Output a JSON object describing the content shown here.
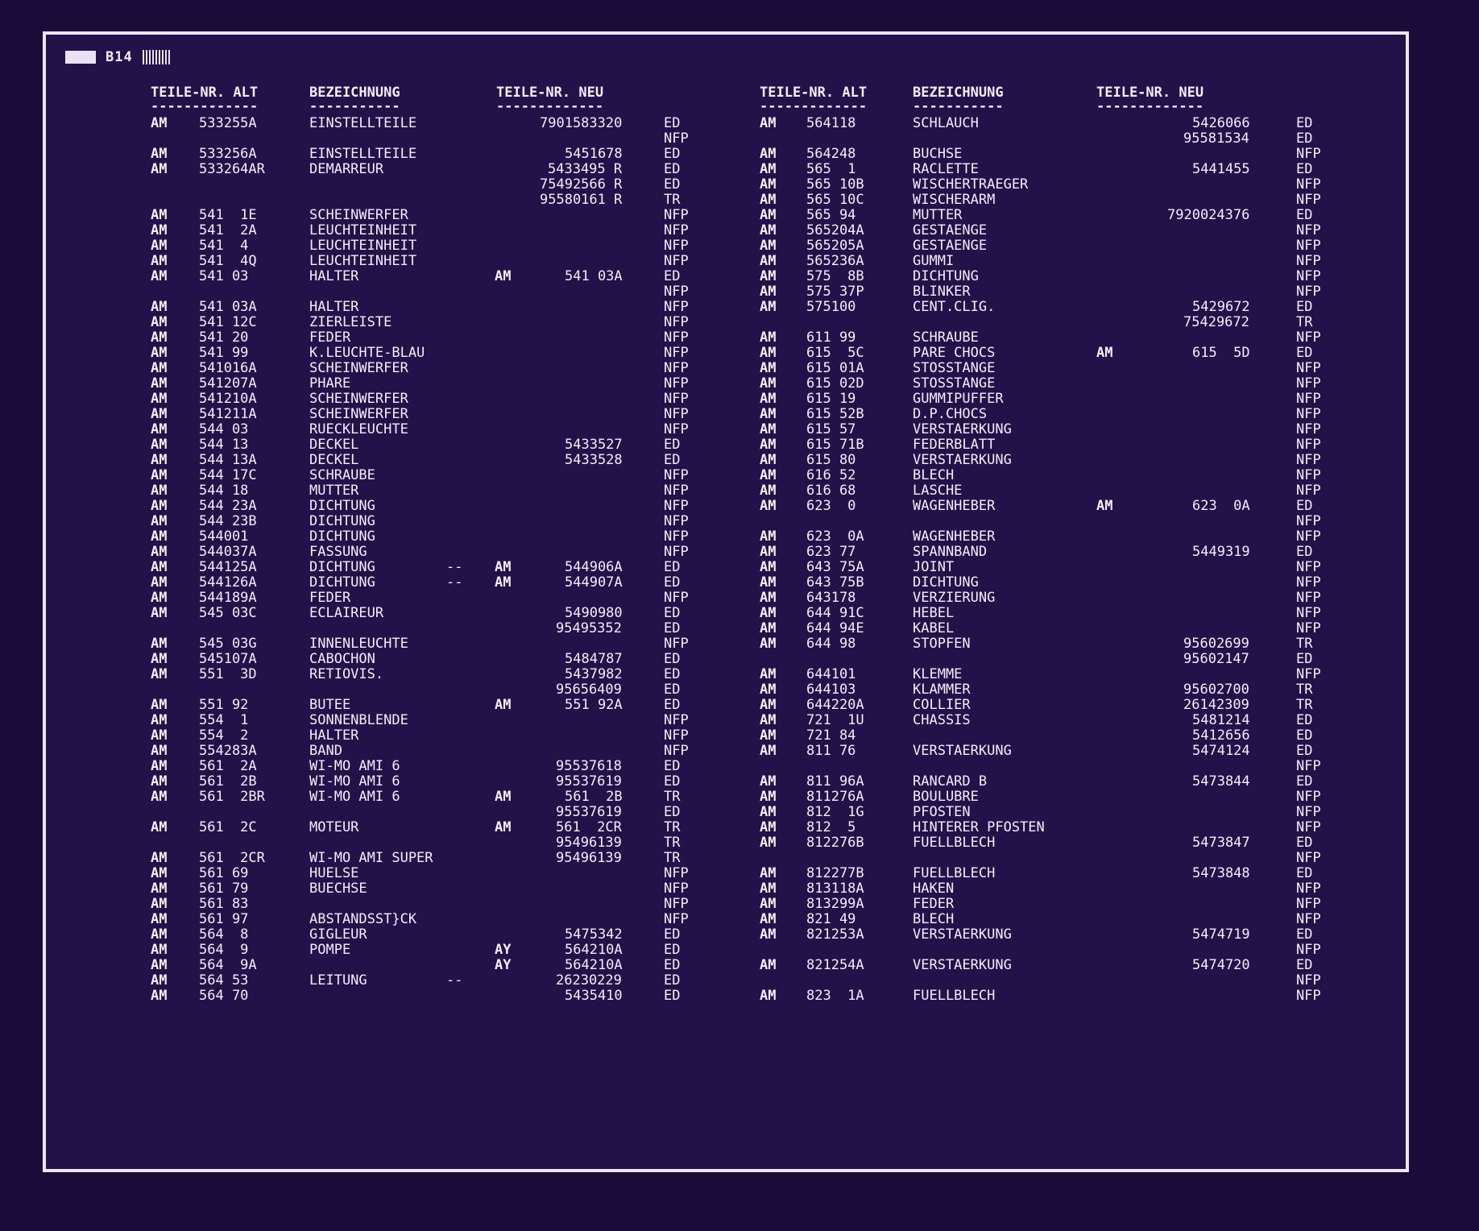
{
  "page_label": "B14",
  "headers": {
    "alt": "TEILE-NR. ALT",
    "bez": "BEZEICHNUNG",
    "neu": "TEILE-NR. NEU",
    "underline_alt": "-------------",
    "underline_bez": "-----------",
    "underline_neu": "-------------"
  },
  "left_rows": [
    {
      "p": "AM",
      "alt": "533255A",
      "bez": "EINSTELLTEILE",
      "neu": "7901583320",
      "code": "ED"
    },
    {
      "p": "",
      "alt": "",
      "bez": "",
      "neu": "",
      "code": "NFP"
    },
    {
      "p": "AM",
      "alt": "533256A",
      "bez": "EINSTELLTEILE",
      "neu": "5451678",
      "code": "ED"
    },
    {
      "p": "AM",
      "alt": "533264AR",
      "bez": "DEMARREUR",
      "neu": "5433495 R",
      "code": "ED"
    },
    {
      "p": "",
      "alt": "",
      "bez": "",
      "neu": "75492566 R",
      "code": "ED"
    },
    {
      "p": "",
      "alt": "",
      "bez": "",
      "neu": "95580161 R",
      "code": "TR"
    },
    {
      "p": "AM",
      "alt": "541  1E",
      "bez": "SCHEINWERFER",
      "neu": "",
      "code": "NFP"
    },
    {
      "p": "AM",
      "alt": "541  2A",
      "bez": "LEUCHTEINHEIT",
      "neu": "",
      "code": "NFP"
    },
    {
      "p": "AM",
      "alt": "541  4",
      "bez": "LEUCHTEINHEIT",
      "neu": "",
      "code": "NFP"
    },
    {
      "p": "AM",
      "alt": "541  4Q",
      "bez": "LEUCHTEINHEIT",
      "neu": "",
      "code": "NFP"
    },
    {
      "p": "AM",
      "alt": "541 03",
      "bez": "HALTER",
      "np": "AM",
      "neu": "541 03A",
      "code": "ED"
    },
    {
      "p": "",
      "alt": "",
      "bez": "",
      "neu": "",
      "code": "NFP"
    },
    {
      "p": "AM",
      "alt": "541 03A",
      "bez": "HALTER",
      "neu": "",
      "code": "NFP"
    },
    {
      "p": "AM",
      "alt": "541 12C",
      "bez": "ZIERLEISTE",
      "neu": "",
      "code": "NFP"
    },
    {
      "p": "AM",
      "alt": "541 20",
      "bez": "FEDER",
      "neu": "",
      "code": "NFP"
    },
    {
      "p": "AM",
      "alt": "541 99",
      "bez": "K.LEUCHTE-BLAU",
      "neu": "",
      "code": "NFP"
    },
    {
      "p": "AM",
      "alt": "541016A",
      "bez": "SCHEINWERFER",
      "neu": "",
      "code": "NFP"
    },
    {
      "p": "AM",
      "alt": "541207A",
      "bez": "PHARE",
      "neu": "",
      "code": "NFP"
    },
    {
      "p": "AM",
      "alt": "541210A",
      "bez": "SCHEINWERFER",
      "neu": "",
      "code": "NFP"
    },
    {
      "p": "AM",
      "alt": "541211A",
      "bez": "SCHEINWERFER",
      "neu": "",
      "code": "NFP"
    },
    {
      "p": "AM",
      "alt": "544 03",
      "bez": "RUECKLEUCHTE",
      "neu": "",
      "code": "NFP"
    },
    {
      "p": "AM",
      "alt": "544 13",
      "bez": "DECKEL",
      "neu": "5433527",
      "code": "ED"
    },
    {
      "p": "AM",
      "alt": "544 13A",
      "bez": "DECKEL",
      "neu": "5433528",
      "code": "ED"
    },
    {
      "p": "AM",
      "alt": "544 17C",
      "bez": "SCHRAUBE",
      "neu": "",
      "code": "NFP"
    },
    {
      "p": "AM",
      "alt": "544 18",
      "bez": "MUTTER",
      "neu": "",
      "code": "NFP"
    },
    {
      "p": "AM",
      "alt": "544 23A",
      "bez": "DICHTUNG",
      "neu": "",
      "code": "NFP"
    },
    {
      "p": "AM",
      "alt": "544 23B",
      "bez": "DICHTUNG",
      "neu": "",
      "code": "NFP"
    },
    {
      "p": "AM",
      "alt": "544001",
      "bez": "DICHTUNG",
      "neu": "",
      "code": "NFP"
    },
    {
      "p": "AM",
      "alt": "544037A",
      "bez": "FASSUNG",
      "neu": "",
      "code": "NFP"
    },
    {
      "p": "AM",
      "alt": "544125A",
      "bez": "DICHTUNG",
      "d": "--",
      "np": "AM",
      "neu": "544906A",
      "code": "ED"
    },
    {
      "p": "AM",
      "alt": "544126A",
      "bez": "DICHTUNG",
      "d": "--",
      "np": "AM",
      "neu": "544907A",
      "code": "ED"
    },
    {
      "p": "AM",
      "alt": "544189A",
      "bez": "FEDER",
      "neu": "",
      "code": "NFP"
    },
    {
      "p": "AM",
      "alt": "545 03C",
      "bez": "ECLAIREUR",
      "neu": "5490980",
      "code": "ED"
    },
    {
      "p": "",
      "alt": "",
      "bez": "",
      "neu": "95495352",
      "code": "ED"
    },
    {
      "p": "AM",
      "alt": "545 03G",
      "bez": "INNENLEUCHTE",
      "neu": "",
      "code": "NFP"
    },
    {
      "p": "AM",
      "alt": "545107A",
      "bez": "CABOCHON",
      "neu": "5484787",
      "code": "ED"
    },
    {
      "p": "AM",
      "alt": "551  3D",
      "bez": "RETIOVIS.",
      "neu": "5437982",
      "code": "ED"
    },
    {
      "p": "",
      "alt": "",
      "bez": "",
      "neu": "95656409",
      "code": "ED"
    },
    {
      "p": "AM",
      "alt": "551 92",
      "bez": "BUTEE",
      "np": "AM",
      "neu": "551 92A",
      "code": "ED"
    },
    {
      "p": "AM",
      "alt": "554  1",
      "bez": "SONNENBLENDE",
      "neu": "",
      "code": "NFP"
    },
    {
      "p": "AM",
      "alt": "554  2",
      "bez": "HALTER",
      "neu": "",
      "code": "NFP"
    },
    {
      "p": "AM",
      "alt": "554283A",
      "bez": "BAND",
      "neu": "",
      "code": "NFP"
    },
    {
      "p": "AM",
      "alt": "561  2A",
      "bez": "WI-MO AMI 6",
      "neu": "95537618",
      "code": "ED"
    },
    {
      "p": "AM",
      "alt": "561  2B",
      "bez": "WI-MO AMI 6",
      "neu": "95537619",
      "code": "ED"
    },
    {
      "p": "AM",
      "alt": "561  2BR",
      "bez": "WI-MO AMI 6",
      "np": "AM",
      "neu": "561  2B",
      "code": "TR"
    },
    {
      "p": "",
      "alt": "",
      "bez": "",
      "neu": "95537619",
      "code": "ED"
    },
    {
      "p": "AM",
      "alt": "561  2C",
      "bez": "MOTEUR",
      "np": "AM",
      "neu": "561  2CR",
      "code": "TR"
    },
    {
      "p": "",
      "alt": "",
      "bez": "",
      "neu": "95496139",
      "code": "TR"
    },
    {
      "p": "AM",
      "alt": "561  2CR",
      "bez": "WI-MO AMI SUPER",
      "neu": "95496139",
      "code": "TR"
    },
    {
      "p": "AM",
      "alt": "561 69",
      "bez": "HUELSE",
      "neu": "",
      "code": "NFP"
    },
    {
      "p": "AM",
      "alt": "561 79",
      "bez": "BUECHSE",
      "neu": "",
      "code": "NFP"
    },
    {
      "p": "AM",
      "alt": "561 83",
      "bez": "",
      "neu": "",
      "code": "NFP"
    },
    {
      "p": "AM",
      "alt": "561 97",
      "bez": "ABSTANDSST}CK",
      "neu": "",
      "code": "NFP"
    },
    {
      "p": "AM",
      "alt": "564  8",
      "bez": "GIGLEUR",
      "neu": "5475342",
      "code": "ED"
    },
    {
      "p": "AM",
      "alt": "564  9",
      "bez": "POMPE",
      "np": "AY",
      "neu": "564210A",
      "code": "ED"
    },
    {
      "p": "AM",
      "alt": "564  9A",
      "bez": "",
      "np": "AY",
      "neu": "564210A",
      "code": "ED"
    },
    {
      "p": "AM",
      "alt": "564 53",
      "bez": "LEITUNG",
      "d": "--",
      "neu": "26230229",
      "code": "ED"
    },
    {
      "p": "AM",
      "alt": "564 70",
      "bez": "",
      "neu": "5435410",
      "code": "ED"
    }
  ],
  "right_rows": [
    {
      "p": "AM",
      "alt": "564118",
      "bez": "SCHLAUCH",
      "neu": "5426066",
      "code": "ED"
    },
    {
      "p": "",
      "alt": "",
      "bez": "",
      "neu": "95581534",
      "code": "ED"
    },
    {
      "p": "AM",
      "alt": "564248",
      "bez": "BUCHSE",
      "neu": "",
      "code": "NFP"
    },
    {
      "p": "AM",
      "alt": "565  1",
      "bez": "RACLETTE",
      "neu": "5441455",
      "code": "ED"
    },
    {
      "p": "AM",
      "alt": "565 10B",
      "bez": "WISCHERTRAEGER",
      "neu": "",
      "code": "NFP"
    },
    {
      "p": "AM",
      "alt": "565 10C",
      "bez": "WISCHERARM",
      "neu": "",
      "code": "NFP"
    },
    {
      "p": "AM",
      "alt": "565 94",
      "bez": "MUTTER",
      "neu": "7920024376",
      "code": "ED"
    },
    {
      "p": "AM",
      "alt": "565204A",
      "bez": "GESTAENGE",
      "neu": "",
      "code": "NFP"
    },
    {
      "p": "AM",
      "alt": "565205A",
      "bez": "GESTAENGE",
      "neu": "",
      "code": "NFP"
    },
    {
      "p": "AM",
      "alt": "565236A",
      "bez": "GUMMI",
      "neu": "",
      "code": "NFP"
    },
    {
      "p": "AM",
      "alt": "575  8B",
      "bez": "DICHTUNG",
      "neu": "",
      "code": "NFP"
    },
    {
      "p": "AM",
      "alt": "575 37P",
      "bez": "BLINKER",
      "neu": "",
      "code": "NFP"
    },
    {
      "p": "AM",
      "alt": "575100",
      "bez": "CENT.CLIG.",
      "neu": "5429672",
      "code": "ED"
    },
    {
      "p": "",
      "alt": "",
      "bez": "",
      "neu": "75429672",
      "code": "TR"
    },
    {
      "p": "AM",
      "alt": "611 99",
      "bez": "SCHRAUBE",
      "neu": "",
      "code": "NFP"
    },
    {
      "p": "AM",
      "alt": "615  5C",
      "bez": "PARE CHOCS",
      "np": "AM",
      "neu": "615  5D",
      "code": "ED"
    },
    {
      "p": "AM",
      "alt": "615 01A",
      "bez": "STOSSTANGE",
      "neu": "",
      "code": "NFP"
    },
    {
      "p": "AM",
      "alt": "615 02D",
      "bez": "STOSSTANGE",
      "neu": "",
      "code": "NFP"
    },
    {
      "p": "AM",
      "alt": "615 19",
      "bez": "GUMMIPUFFER",
      "neu": "",
      "code": "NFP"
    },
    {
      "p": "AM",
      "alt": "615 52B",
      "bez": "D.P.CHOCS",
      "neu": "",
      "code": "NFP"
    },
    {
      "p": "AM",
      "alt": "615 57",
      "bez": "VERSTAERKUNG",
      "neu": "",
      "code": "NFP"
    },
    {
      "p": "AM",
      "alt": "615 71B",
      "bez": "FEDERBLATT",
      "neu": "",
      "code": "NFP"
    },
    {
      "p": "AM",
      "alt": "615 80",
      "bez": "VERSTAERKUNG",
      "neu": "",
      "code": "NFP"
    },
    {
      "p": "AM",
      "alt": "616 52",
      "bez": "BLECH",
      "neu": "",
      "code": "NFP"
    },
    {
      "p": "AM",
      "alt": "616 68",
      "bez": "LASCHE",
      "neu": "",
      "code": "NFP"
    },
    {
      "p": "AM",
      "alt": "623  0",
      "bez": "WAGENHEBER",
      "np": "AM",
      "neu": "623  0A",
      "code": "ED"
    },
    {
      "p": "",
      "alt": "",
      "bez": "",
      "neu": "",
      "code": "NFP"
    },
    {
      "p": "AM",
      "alt": "623  0A",
      "bez": "WAGENHEBER",
      "neu": "",
      "code": "NFP"
    },
    {
      "p": "AM",
      "alt": "623 77",
      "bez": "SPANNBAND",
      "neu": "5449319",
      "code": "ED"
    },
    {
      "p": "AM",
      "alt": "643 75A",
      "bez": "JOINT",
      "neu": "",
      "code": "NFP"
    },
    {
      "p": "AM",
      "alt": "643 75B",
      "bez": "DICHTUNG",
      "neu": "",
      "code": "NFP"
    },
    {
      "p": "AM",
      "alt": "643178",
      "bez": "VERZIERUNG",
      "neu": "",
      "code": "NFP"
    },
    {
      "p": "AM",
      "alt": "644 91C",
      "bez": "HEBEL",
      "neu": "",
      "code": "NFP"
    },
    {
      "p": "AM",
      "alt": "644 94E",
      "bez": "KABEL",
      "neu": "",
      "code": "NFP"
    },
    {
      "p": "AM",
      "alt": "644 98",
      "bez": "STOPFEN",
      "neu": "95602699",
      "code": "TR"
    },
    {
      "p": "",
      "alt": "",
      "bez": "",
      "neu": "95602147",
      "code": "ED"
    },
    {
      "p": "AM",
      "alt": "644101",
      "bez": "KLEMME",
      "neu": "",
      "code": "NFP"
    },
    {
      "p": "AM",
      "alt": "644103",
      "bez": "KLAMMER",
      "neu": "95602700",
      "code": "TR"
    },
    {
      "p": "AM",
      "alt": "644220A",
      "bez": "COLLIER",
      "neu": "26142309",
      "code": "TR"
    },
    {
      "p": "AM",
      "alt": "721  1U",
      "bez": "CHASSIS",
      "neu": "5481214",
      "code": "ED"
    },
    {
      "p": "AM",
      "alt": "721 84",
      "bez": "",
      "neu": "5412656",
      "code": "ED"
    },
    {
      "p": "AM",
      "alt": "811 76",
      "bez": "VERSTAERKUNG",
      "neu": "5474124",
      "code": "ED"
    },
    {
      "p": "",
      "alt": "",
      "bez": "",
      "neu": "",
      "code": "NFP"
    },
    {
      "p": "AM",
      "alt": "811 96A",
      "bez": "RANCARD B",
      "neu": "5473844",
      "code": "ED"
    },
    {
      "p": "AM",
      "alt": "811276A",
      "bez": "BOULUBRE",
      "neu": "",
      "code": "NFP"
    },
    {
      "p": "AM",
      "alt": "812  1G",
      "bez": "PFOSTEN",
      "neu": "",
      "code": "NFP"
    },
    {
      "p": "AM",
      "alt": "812  5",
      "bez": "HINTERER PFOSTEN",
      "neu": "",
      "code": "NFP"
    },
    {
      "p": "AM",
      "alt": "812276B",
      "bez": "FUELLBLECH",
      "neu": "5473847",
      "code": "ED"
    },
    {
      "p": "",
      "alt": "",
      "bez": "",
      "neu": "",
      "code": "NFP"
    },
    {
      "p": "AM",
      "alt": "812277B",
      "bez": "FUELLBLECH",
      "neu": "5473848",
      "code": "ED"
    },
    {
      "p": "AM",
      "alt": "813118A",
      "bez": "HAKEN",
      "neu": "",
      "code": "NFP"
    },
    {
      "p": "AM",
      "alt": "813299A",
      "bez": "FEDER",
      "neu": "",
      "code": "NFP"
    },
    {
      "p": "AM",
      "alt": "821 49",
      "bez": "BLECH",
      "neu": "",
      "code": "NFP"
    },
    {
      "p": "AM",
      "alt": "821253A",
      "bez": "VERSTAERKUNG",
      "neu": "5474719",
      "code": "ED"
    },
    {
      "p": "",
      "alt": "",
      "bez": "",
      "neu": "",
      "code": "NFP"
    },
    {
      "p": "AM",
      "alt": "821254A",
      "bez": "VERSTAERKUNG",
      "neu": "5474720",
      "code": "ED"
    },
    {
      "p": "",
      "alt": "",
      "bez": "",
      "neu": "",
      "code": "NFP"
    },
    {
      "p": "AM",
      "alt": "823  1A",
      "bez": "FUELLBLECH",
      "neu": "",
      "code": "NFP"
    }
  ]
}
